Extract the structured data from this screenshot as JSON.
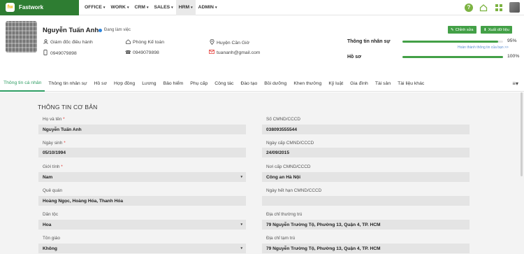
{
  "brand": {
    "name": "Fastwork",
    "logo_letter": "fw"
  },
  "nav": [
    {
      "label": "OFFICE",
      "caret": "▾"
    },
    {
      "label": "WORK",
      "caret": "▾"
    },
    {
      "label": "CRM",
      "caret": "▾"
    },
    {
      "label": "SALES",
      "caret": "▾"
    },
    {
      "label": "HRM",
      "caret": "▾"
    },
    {
      "label": "ADMIN",
      "caret": "▾"
    }
  ],
  "active_nav": "HRM",
  "top_icons": [
    "help-icon",
    "home-icon",
    "apps-icon",
    "user-avatar"
  ],
  "profile": {
    "name": "Nguyễn Tuấn Anh",
    "status": "Đang làm việc",
    "position": "Giám đốc điều hành",
    "department": "Phòng Kế toán",
    "location": "Huyện Cần Giờ",
    "mobile": "0949079898",
    "phone": "0949079898",
    "email": "tuananh@gmail.com"
  },
  "actions": {
    "edit": "Chỉnh sửa",
    "export": "Xuất dữ liệu"
  },
  "progress": [
    {
      "label": "Thông tin nhân sự",
      "percent": 95,
      "value_text": "95%",
      "hint": "Hoàn thành thông tin của bạn >>"
    },
    {
      "label": "Hồ sơ",
      "percent": 100,
      "value_text": "100%"
    }
  ],
  "tabs": [
    "Thông tin cá nhân",
    "Thông tin nhân sự",
    "Hồ sơ",
    "Hợp đồng",
    "Lương",
    "Bảo hiểm",
    "Phụ cấp",
    "Công tác",
    "Đào tạo",
    "Bồi dưỡng",
    "Khen thưởng",
    "Kỷ luật",
    "Gia đình",
    "Tài sản",
    "Tài liệu khác"
  ],
  "tabs_menu": "≡▾",
  "section": {
    "title": "THÔNG TIN CƠ BẢN"
  },
  "form": {
    "left": [
      {
        "label": "Họ và tên",
        "required": "*",
        "value": "Nguyễn Tuấn Anh",
        "dropdown": ""
      },
      {
        "label": "Ngày sinh",
        "required": "*",
        "value": "05/10/1994",
        "dropdown": ""
      },
      {
        "label": "Giới tính",
        "required": "*",
        "value": "Nam",
        "dropdown": "▾"
      },
      {
        "label": "Quê quán",
        "required": "",
        "value": "Hoàng Ngọc, Hoàng Hóa, Thanh Hóa",
        "dropdown": ""
      },
      {
        "label": "Dân tộc",
        "required": "",
        "value": "Hoa",
        "dropdown": "▾"
      },
      {
        "label": "Tôn giáo",
        "required": "",
        "value": "Không",
        "dropdown": "▾"
      }
    ],
    "right": [
      {
        "label": "Số CMND/CCCD",
        "value": "038093555544"
      },
      {
        "label": "Ngày cấp CMND/CCCD",
        "value": "24/09/2015"
      },
      {
        "label": "Nơi cấp CMND/CCCD",
        "value": "Công an Hà Nội"
      },
      {
        "label": "Ngày hết hạn CMND/CCCD",
        "value": ""
      },
      {
        "label": "Địa chỉ thường trú",
        "value": "79 Nguyễn Trường Tộ, Phường 13, Quận 4, TP. HCM"
      },
      {
        "label": "Địa chỉ tạm trú",
        "value": "79 Nguyễn Trường Tộ, Phường 13, Quận 4, TP. HCM"
      }
    ]
  },
  "colors": {
    "brand": "#2e7d32",
    "accent": "#43a047",
    "active_tab": "#2e9d63",
    "status_dot": "#2e86de"
  }
}
